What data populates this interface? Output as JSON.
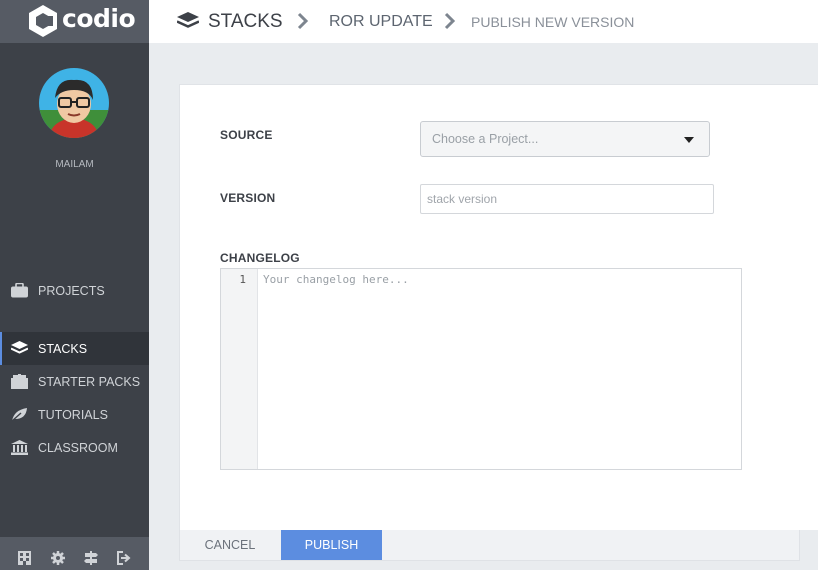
{
  "app": {
    "logo_text": "codio"
  },
  "user": {
    "name": "MAILAM"
  },
  "sidebar": {
    "items": [
      {
        "label": "PROJECTS",
        "icon": "briefcase-icon"
      },
      {
        "label": "STACKS",
        "icon": "stacks-layers-icon",
        "active": true
      },
      {
        "label": "STARTER PACKS",
        "icon": "package-icon"
      },
      {
        "label": "TUTORIALS",
        "icon": "leaf-icon"
      },
      {
        "label": "CLASSROOM",
        "icon": "bank-icon"
      }
    ],
    "bottom_icons": [
      "building-icon",
      "gear-icon",
      "signpost-icon",
      "logout-icon"
    ]
  },
  "breadcrumb": {
    "items": [
      "STACKS",
      "ROR UPDATE",
      "PUBLISH NEW VERSION"
    ]
  },
  "form": {
    "source_label": "SOURCE",
    "source_placeholder": "Choose a Project...",
    "version_label": "VERSION",
    "version_placeholder": "stack version",
    "changelog_label": "CHANGELOG",
    "changelog_line_number": "1",
    "changelog_placeholder": "Your changelog here..."
  },
  "actions": {
    "cancel_label": "CANCEL",
    "publish_label": "PUBLISH"
  },
  "colors": {
    "sidebar_bg": "#3d4148",
    "accent": "#5c8de0"
  }
}
